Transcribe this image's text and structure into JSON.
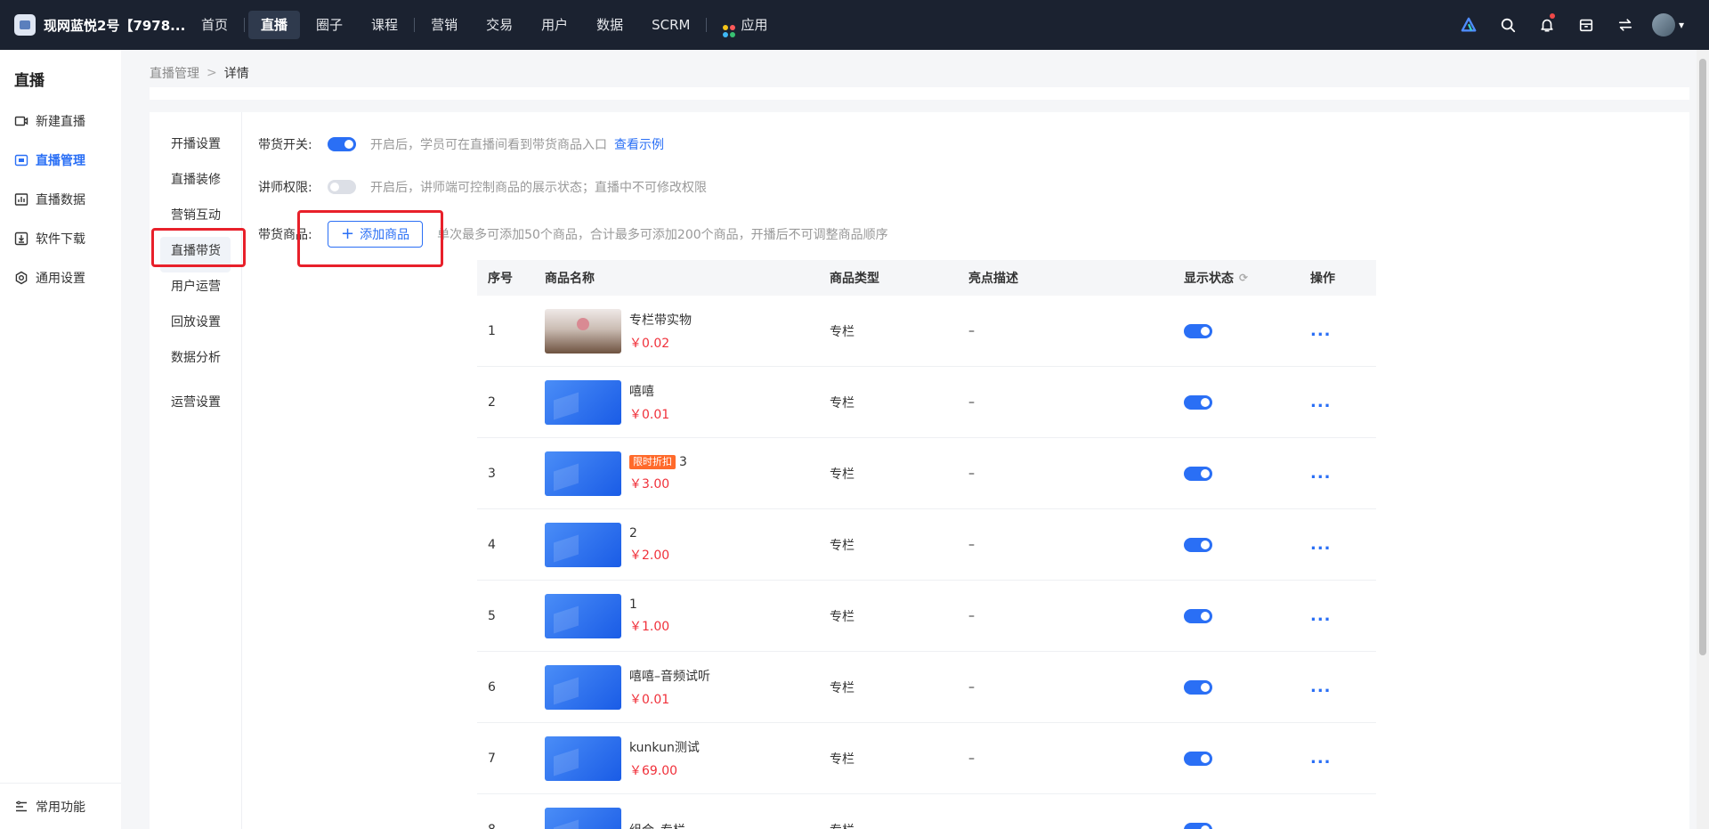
{
  "topbar": {
    "brand": "现网蓝悦2号【7978...",
    "nav": [
      "首页",
      "直播",
      "圈子",
      "课程",
      "营销",
      "交易",
      "用户",
      "数据",
      "SCRM",
      "应用"
    ],
    "active_nav": "直播"
  },
  "sidebar": {
    "title": "直播",
    "items": [
      {
        "label": "新建直播",
        "icon": "video-plus-icon"
      },
      {
        "label": "直播管理",
        "icon": "live-manage-icon"
      },
      {
        "label": "直播数据",
        "icon": "chart-icon"
      },
      {
        "label": "软件下载",
        "icon": "download-icon"
      },
      {
        "label": "通用设置",
        "icon": "gear-icon"
      }
    ],
    "footer": "常用功能"
  },
  "breadcrumb": {
    "parent": "直播管理",
    "sep": ">",
    "current": "详情"
  },
  "subnav": [
    "开播设置",
    "直播装修",
    "营销互动",
    "直播带货",
    "用户运营",
    "回放设置",
    "数据分析",
    "运营设置"
  ],
  "settings": {
    "sell_switch": {
      "label": "带货开关:",
      "hint": "开启后，学员可在直播间看到带货商品入口",
      "link": "查看示例",
      "on": true
    },
    "lecturer": {
      "label": "讲师权限:",
      "hint": "开启后，讲师端可控制商品的展示状态；直播中不可修改权限",
      "on": false
    },
    "goods": {
      "label": "带货商品:",
      "button": "添加商品",
      "hint": "单次最多可添加50个商品，合计最多可添加200个商品，开播后不可调整商品顺序"
    }
  },
  "table": {
    "headers": [
      "序号",
      "商品名称",
      "商品类型",
      "亮点描述",
      "显示状态",
      "操作"
    ],
    "rows": [
      {
        "idx": "1",
        "name": "专栏带实物",
        "tag": "",
        "price": "￥0.02",
        "type": "专栏",
        "desc": "–",
        "op": "...",
        "photo": true
      },
      {
        "idx": "2",
        "name": "嘻嘻",
        "tag": "",
        "price": "￥0.01",
        "type": "专栏",
        "desc": "–",
        "op": "...",
        "photo": false
      },
      {
        "idx": "3",
        "name": "3",
        "tag": "限时折扣",
        "price": "￥3.00",
        "type": "专栏",
        "desc": "–",
        "op": "...",
        "photo": false
      },
      {
        "idx": "4",
        "name": "2",
        "tag": "",
        "price": "￥2.00",
        "type": "专栏",
        "desc": "–",
        "op": "...",
        "photo": false
      },
      {
        "idx": "5",
        "name": "1",
        "tag": "",
        "price": "￥1.00",
        "type": "专栏",
        "desc": "–",
        "op": "...",
        "photo": false
      },
      {
        "idx": "6",
        "name": "嘻嘻–音频试听",
        "tag": "",
        "price": "￥0.01",
        "type": "专栏",
        "desc": "–",
        "op": "...",
        "photo": false
      },
      {
        "idx": "7",
        "name": "kunkun测试",
        "tag": "",
        "price": "￥69.00",
        "type": "专栏",
        "desc": "–",
        "op": "...",
        "photo": false
      },
      {
        "idx": "8",
        "name": "组合–专栏",
        "tag": "",
        "price": "",
        "type": "专栏",
        "desc": "–",
        "op": "...",
        "photo": false
      }
    ]
  },
  "colors": {
    "accent": "#2a6ff5",
    "topbar": "#1b2230",
    "price": "#f0303a",
    "annotation": "#e8202a"
  }
}
